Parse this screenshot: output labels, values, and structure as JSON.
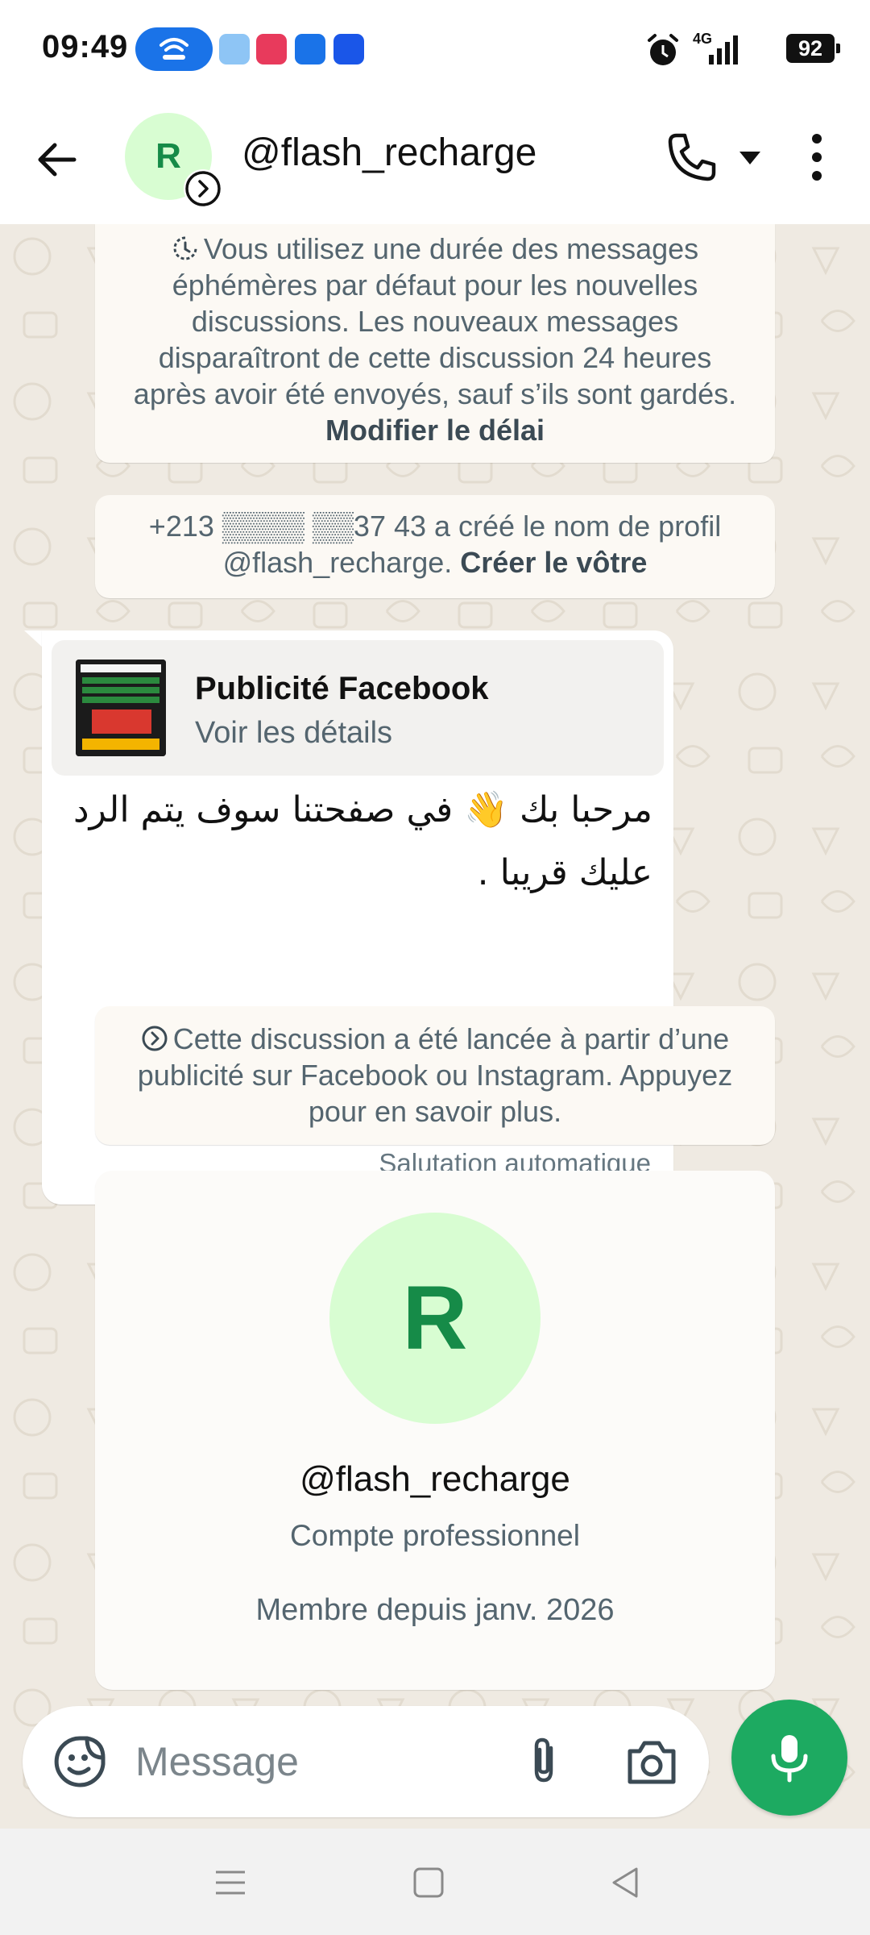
{
  "status_bar": {
    "time": "09:49",
    "network": "4G",
    "battery": "92"
  },
  "header": {
    "avatar_letter": "R",
    "title": "@flash_recharge"
  },
  "system_messages": {
    "disappearing": {
      "text": "Vous utilisez une durée des messages éphémères par défaut pour les nouvelles discussions. Les nouveaux messages disparaîtront de cette discussion 24 heures après avoir été envoyés, sauf s’ils sont gardés.",
      "link": "Modifier le délai"
    },
    "profile_name": {
      "text": "+213 ▒▒▒▒ ▒▒37 43 a créé le nom de profil @flash_recharge.",
      "link": "Créer le vôtre"
    },
    "ad_origin": {
      "text": "Cette discussion a été lancée à partir d’une publicité sur Facebook ou Instagram. Appuyez pour en savoir plus."
    }
  },
  "message": {
    "ad_title": "Publicité Facebook",
    "ad_subtitle": "Voir les détails",
    "text": "مرحبا بك 👋 في صفحتنا سوف يتم الرد عليك قريبا .",
    "meta": "Salutation automatique"
  },
  "profile_card": {
    "avatar_letter": "R",
    "name": "@flash_recharge",
    "account_type": "Compte professionnel",
    "member_since": "Membre depuis janv. 2026"
  },
  "composer": {
    "placeholder": "Message"
  },
  "colors": {
    "accent_green": "#1daa61",
    "avatar_bg": "#d8fdd2",
    "avatar_text": "#168b48",
    "chat_bg": "#efeae2"
  }
}
